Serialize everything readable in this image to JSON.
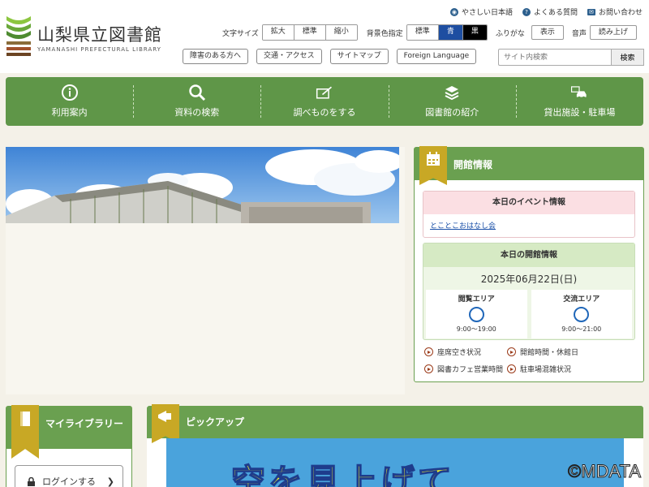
{
  "site": {
    "title_jp": "山梨県立図書館",
    "title_en": "YAMANASHI PREFECTURAL LIBRARY"
  },
  "util_links": [
    {
      "label": "やさしい日本語",
      "icon": "globe-icon"
    },
    {
      "label": "よくある質問",
      "icon": "question-icon"
    },
    {
      "label": "お問い合わせ",
      "icon": "mail-icon"
    }
  ],
  "controls": {
    "font_size_label": "文字サイズ",
    "font_sizes": [
      "拡大",
      "標準",
      "縮小"
    ],
    "bg_label": "背景色指定",
    "bg_options": [
      "標準",
      "青",
      "黒"
    ],
    "furigana_label": "ふりがな",
    "furigana_button": "表示",
    "speech_label": "音声",
    "speech_button": "読み上げ"
  },
  "nav_links": [
    "障害のある方へ",
    "交通・アクセス",
    "サイトマップ",
    "Foreign Language"
  ],
  "search": {
    "placeholder": "サイト内検索",
    "button": "検索"
  },
  "main_nav": [
    {
      "label": "利用案内",
      "icon": "info-icon"
    },
    {
      "label": "資料の検索",
      "icon": "magnifier-icon"
    },
    {
      "label": "調べものをする",
      "icon": "notebook-pen-icon"
    },
    {
      "label": "図書館の紹介",
      "icon": "books-icon"
    },
    {
      "label": "貸出施設・駐車場",
      "icon": "car-icon"
    }
  ],
  "opening": {
    "title": "開館情報",
    "event_title": "本日のイベント情報",
    "event_link": "とことこおはなし会",
    "today_title": "本日の開館情報",
    "date": "2025年06月22日(日)",
    "areas": [
      {
        "name": "閲覧エリア",
        "hours": "9:00〜19:00",
        "status_icon": "open-circle-icon"
      },
      {
        "name": "交流エリア",
        "hours": "9:00〜21:00",
        "status_icon": "open-circle-icon"
      }
    ],
    "links": [
      "座席空き状況",
      "開館時間・休館日",
      "図書カフェ営業時間",
      "駐車場混雑状況"
    ]
  },
  "my_library": {
    "title": "マイライブラリー",
    "login": "ログインする"
  },
  "pickup": {
    "title": "ピックアップ",
    "banner_text": "空を見上げて"
  },
  "watermark": "©MDATA"
}
